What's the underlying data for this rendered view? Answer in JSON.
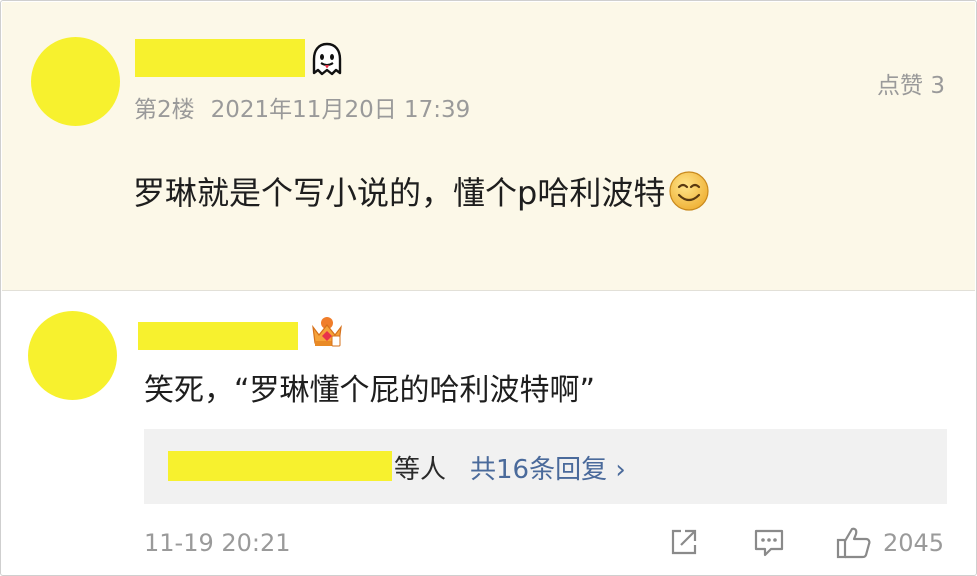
{
  "floor": {
    "floor_label": "第2楼",
    "datetime": "2021年11月20日 17:39",
    "likes": "点赞 3",
    "text": "罗琳就是个写小说的，懂个p哈利波特"
  },
  "reply": {
    "text": "笑死，“罗琳懂个屁的哈利波特啊”",
    "sub_replies": {
      "others": "等人",
      "link": "共16条回复 ›"
    },
    "time": "11-19 20:21",
    "like_count": "2045"
  },
  "colors": {
    "floor_bg": "#fcf8e8",
    "mask": "#f7f12e",
    "link": "#4a6a9b",
    "meta_gray": "#9a9a9a"
  },
  "icons": [
    "ghost-icon",
    "smile-icon",
    "crown-icon",
    "share-icon",
    "comment-icon",
    "thumbs-up-icon"
  ]
}
